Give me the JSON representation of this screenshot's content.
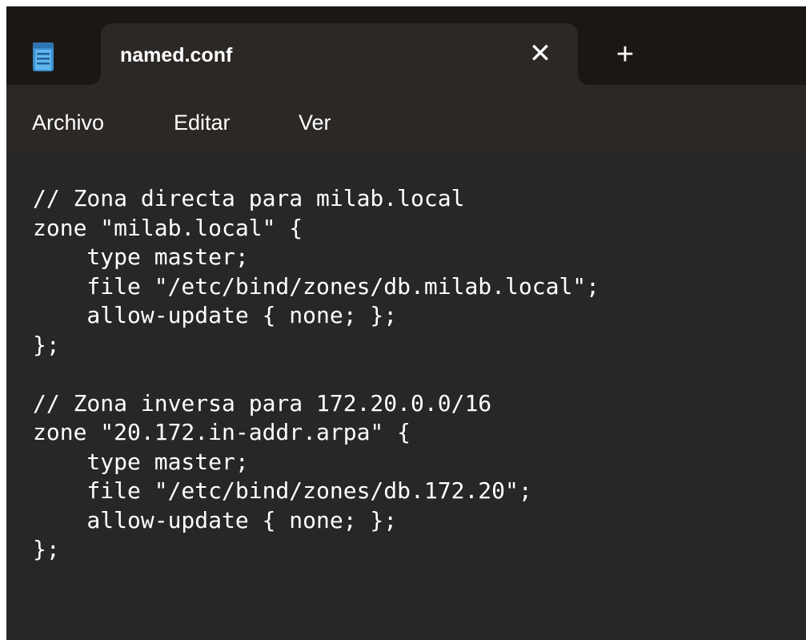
{
  "tab": {
    "title": "named.conf",
    "close_glyph": "✕",
    "add_glyph": "+",
    "icon": "notepad-icon"
  },
  "menu": {
    "items": [
      "Archivo",
      "Editar",
      "Ver"
    ]
  },
  "editor": {
    "lines": [
      "// Zona directa para milab.local",
      "zone \"milab.local\" {",
      "    type master;",
      "    file \"/etc/bind/zones/db.milab.local\";",
      "    allow-update { none; };",
      "};",
      "",
      "// Zona inversa para 172.20.0.0/16",
      "zone \"20.172.in-addr.arpa\" {",
      "    type master;",
      "    file \"/etc/bind/zones/db.172.20\";",
      "    allow-update { none; };",
      "};"
    ]
  },
  "colors": {
    "titlebar": "#1c1714",
    "tab_active": "#2b2826",
    "editor_bg": "#272727",
    "text": "#ffffff",
    "icon_accent": "#4aa3df"
  }
}
